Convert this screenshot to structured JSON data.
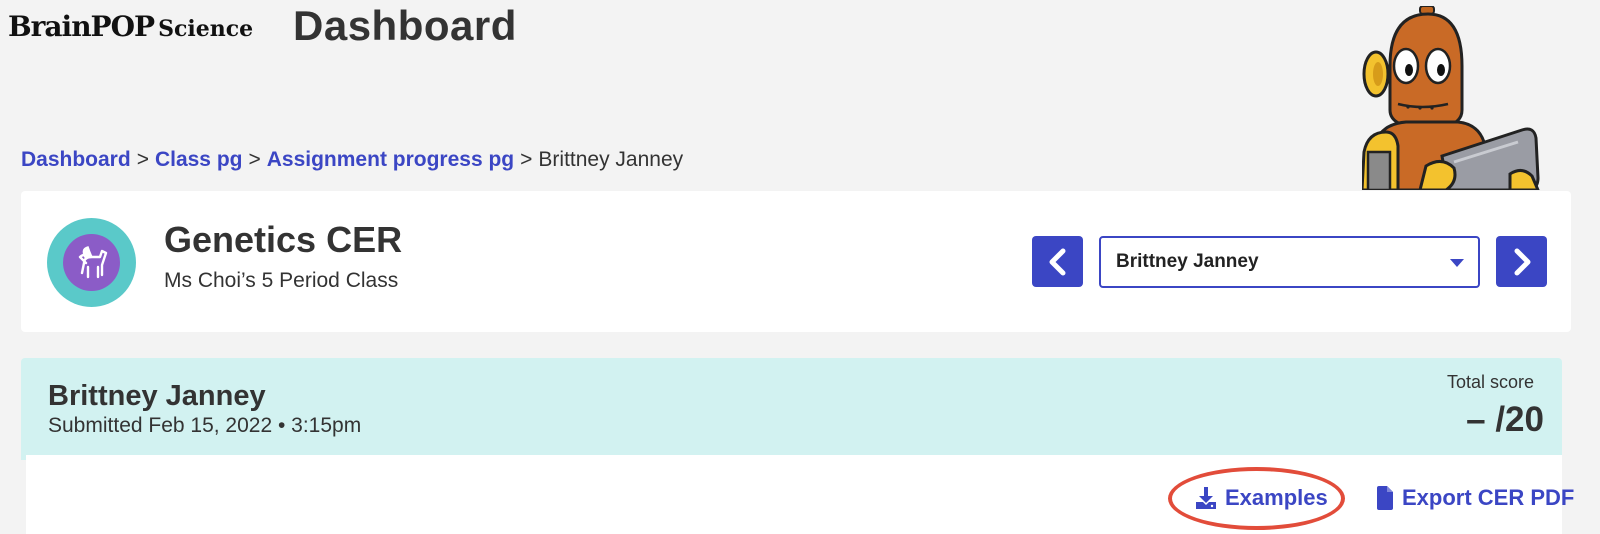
{
  "header": {
    "logo_brand": "BrainPOP",
    "logo_sub": "Science",
    "page_title": "Dashboard"
  },
  "breadcrumb": {
    "items": [
      "Dashboard",
      "Class pg",
      "Assignment progress pg"
    ],
    "separator": ">",
    "current": "Brittney Janney"
  },
  "assignment": {
    "title": "Genetics CER",
    "class_name": "Ms Choi’s 5 Period Class",
    "avatar_icon": "pegasus-icon"
  },
  "student_picker": {
    "selected": "Brittney Janney",
    "prev_icon": "chevron-left-icon",
    "next_icon": "chevron-right-icon"
  },
  "submission": {
    "student_name": "Brittney Janney",
    "submitted": "Submitted Feb 15, 2022 • 3:15pm",
    "score_label": "Total score",
    "score_value": "– /20"
  },
  "actions": {
    "examples_label": "Examples",
    "examples_icon": "download-icon",
    "export_label": "Export CER PDF",
    "export_icon": "document-icon"
  },
  "colors": {
    "accent": "#3b46c4",
    "teal_panel": "#d2f2f1",
    "highlight": "#e24c3a"
  }
}
